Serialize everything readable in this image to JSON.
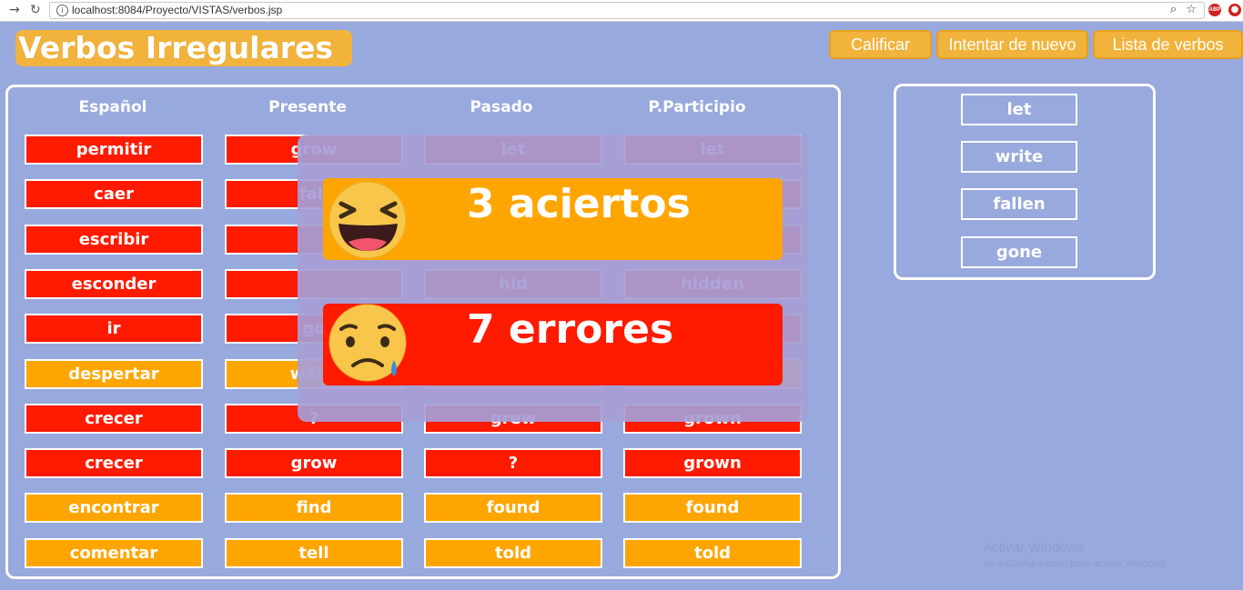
{
  "browser": {
    "back_icon": "arrow-right-icon",
    "reload_icon": "reload-icon",
    "url": "localhost:8084/Proyecto/VISTAS/verbos.jsp",
    "zoom_icon": "magnifier-icon",
    "star_icon": "star-icon",
    "abp_label": "ABP"
  },
  "app": {
    "title": "Verbos Irregulares",
    "buttons": {
      "grade": "Calificar",
      "retry": "Intentar de nuevo",
      "list": "Lista de verbos"
    }
  },
  "table": {
    "headers": [
      "Español",
      "Presente",
      "Pasado",
      "P.Participio"
    ],
    "rows": [
      {
        "status": "red",
        "cells": [
          "permitir",
          "grow",
          "let",
          "let"
        ]
      },
      {
        "status": "red",
        "cells": [
          "caer",
          "fall",
          "",
          ""
        ]
      },
      {
        "status": "red",
        "cells": [
          "escribir",
          "",
          "?",
          ""
        ]
      },
      {
        "status": "red",
        "cells": [
          "esconder",
          "",
          "hid",
          "hidden"
        ]
      },
      {
        "status": "red",
        "cells": [
          "ir",
          "go",
          "",
          ""
        ]
      },
      {
        "status": "orange",
        "cells": [
          "despertar",
          "wake",
          "",
          ""
        ]
      },
      {
        "status": "red",
        "cells": [
          "crecer",
          "?",
          "grew",
          "grown"
        ]
      },
      {
        "status": "red",
        "cells": [
          "crecer",
          "grow",
          "?",
          "grown"
        ]
      },
      {
        "status": "orange",
        "cells": [
          "encontrar",
          "find",
          "found",
          "found"
        ]
      },
      {
        "status": "orange",
        "cells": [
          "comentar",
          "tell",
          "told",
          "told"
        ]
      }
    ]
  },
  "overlay": {
    "correct": {
      "text": "3 aciertos",
      "icon": "laughing-emoji-icon"
    },
    "wrong": {
      "text": "7 errores",
      "icon": "crying-emoji-icon"
    }
  },
  "word_bank": {
    "words": [
      "let",
      "write",
      "fallen",
      "gone"
    ]
  },
  "watermark": {
    "line1": "Activar Windows",
    "line2": "Ve a Configuración para activar Windows."
  },
  "colors": {
    "background": "#98a9dd",
    "correct": "#ffa500",
    "wrong": "#ff1a00",
    "title_bg": "#f2b33c"
  }
}
